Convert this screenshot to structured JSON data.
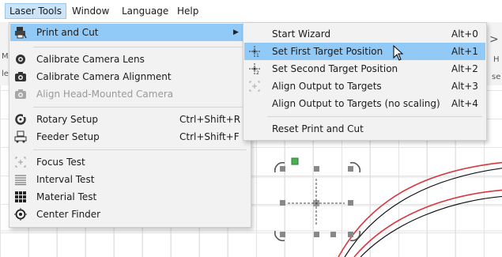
{
  "menubar": {
    "items": [
      {
        "label": "Laser Tools",
        "active": true
      },
      {
        "label": "Window"
      },
      {
        "label": "Language"
      },
      {
        "label": "Help"
      }
    ]
  },
  "menu": {
    "items": [
      {
        "label": "Print and Cut",
        "icon": "print-and-cut-icon",
        "submenu": true,
        "highlighted": true
      },
      {
        "label": "Calibrate Camera Lens",
        "icon": "camera-lens-icon"
      },
      {
        "label": "Calibrate Camera Alignment",
        "icon": "camera-icon"
      },
      {
        "label": "Align Head-Mounted Camera",
        "icon": "camera-icon",
        "disabled": true
      },
      {
        "label": "Rotary Setup",
        "icon": "rotary-icon",
        "shortcut": "Ctrl+Shift+R"
      },
      {
        "label": "Feeder Setup",
        "icon": "feeder-icon",
        "shortcut": "Ctrl+Shift+F"
      },
      {
        "label": "Focus Test",
        "icon": "focus-test-icon"
      },
      {
        "label": "Interval Test",
        "icon": "interval-test-icon"
      },
      {
        "label": "Material Test",
        "icon": "material-test-icon"
      },
      {
        "label": "Center Finder",
        "icon": "center-finder-icon"
      }
    ]
  },
  "submenu": {
    "items": [
      {
        "label": "Start Wizard",
        "shortcut": "Alt+0"
      },
      {
        "label": "Set First Target Position",
        "shortcut": "Alt+1",
        "icon": "first-target-icon",
        "highlighted": true
      },
      {
        "label": "Set Second Target Position",
        "shortcut": "Alt+2",
        "icon": "second-target-icon"
      },
      {
        "label": "Align Output to Targets",
        "shortcut": "Alt+3",
        "icon": "align-targets-icon"
      },
      {
        "label": "Align Output to Targets (no scaling)",
        "shortcut": "Alt+4"
      },
      {
        "label": "Reset Print and Cut"
      }
    ]
  },
  "colors": {
    "highlight": "#91c9f7",
    "menu_bg": "#f2f2f2",
    "curve_red": "#d9363e",
    "handle_green": "#4caf50"
  }
}
